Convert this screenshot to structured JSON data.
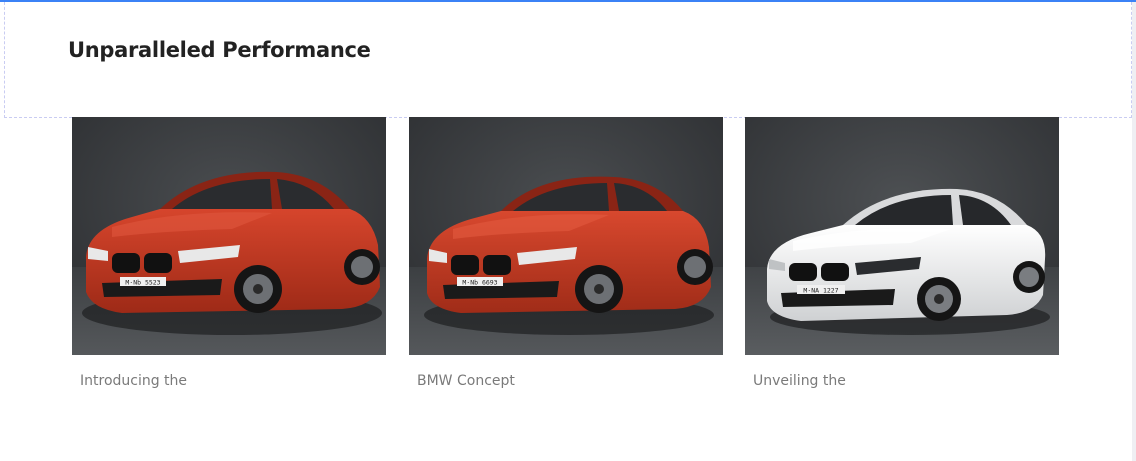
{
  "section": {
    "title": "Unparalleled Performance"
  },
  "cards": [
    {
      "caption": "Introducing the",
      "image": "red-bmw-sedan",
      "car_color": "#c2361f",
      "plate": "M·Nb 5523"
    },
    {
      "caption": "BMW Concept",
      "image": "red-bmw-sedan",
      "car_color": "#c63a22",
      "plate": "M·Nb 6693"
    },
    {
      "caption": "Unveiling the",
      "image": "white-bmw-sedan",
      "car_color": "#f2f2f2",
      "plate": "M·NA 1227"
    }
  ],
  "colors": {
    "accent": "#3b82f6",
    "title": "#222222",
    "caption": "#7a7a7a",
    "studio_background": "#3a3d40"
  }
}
